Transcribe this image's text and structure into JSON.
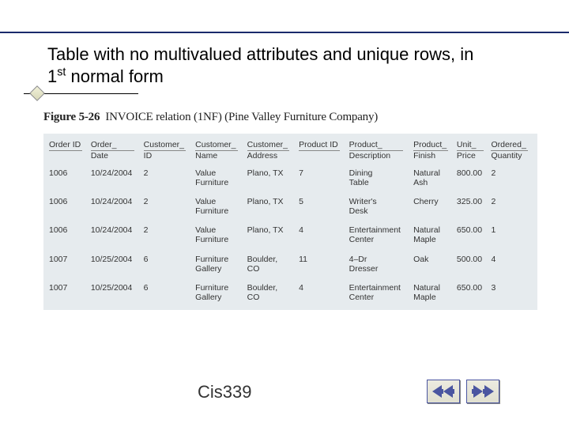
{
  "title_line1": "Table with no multivalued attributes and unique rows, in",
  "title_line2a": "1",
  "title_line2sup": "st",
  "title_line2b": " normal form",
  "figure": {
    "label": "Figure 5-26",
    "desc": "INVOICE relation (1NF) (Pine Valley Furniture Company)"
  },
  "table": {
    "headers": [
      {
        "l1": "Order ID",
        "l2": ""
      },
      {
        "l1": "Order_",
        "l2": "Date"
      },
      {
        "l1": "Customer_",
        "l2": "ID"
      },
      {
        "l1": "Customer_",
        "l2": "Name"
      },
      {
        "l1": "Customer_",
        "l2": "Address"
      },
      {
        "l1": "Product ID",
        "l2": ""
      },
      {
        "l1": "Product_",
        "l2": "Description"
      },
      {
        "l1": "Product_",
        "l2": "Finish"
      },
      {
        "l1": "Unit_",
        "l2": "Price"
      },
      {
        "l1": "Ordered_",
        "l2": "Quantity"
      }
    ],
    "rows": [
      [
        "1006",
        "10/24/2004",
        "2",
        "Value\nFurniture",
        "Plano, TX",
        "7",
        "Dining\nTable",
        "Natural\nAsh",
        "800.00",
        "2"
      ],
      [
        "1006",
        "10/24/2004",
        "2",
        "Value\nFurniture",
        "Plano, TX",
        "5",
        "Writer's\nDesk",
        "Cherry",
        "325.00",
        "2"
      ],
      [
        "1006",
        "10/24/2004",
        "2",
        "Value\nFurniture",
        "Plano, TX",
        "4",
        "Entertainment\nCenter",
        "Natural\nMaple",
        "650.00",
        "1"
      ],
      [
        "1007",
        "10/25/2004",
        "6",
        "Furniture\nGallery",
        "Boulder,\nCO",
        "11",
        "4–Dr\nDresser",
        "Oak",
        "500.00",
        "4"
      ],
      [
        "1007",
        "10/25/2004",
        "6",
        "Furniture\nGallery",
        "Boulder,\nCO",
        "4",
        "Entertainment\nCenter",
        "Natural\nMaple",
        "650.00",
        "3"
      ]
    ]
  },
  "footer": "Cis339",
  "nav": {
    "prev": "prev",
    "next": "next"
  },
  "colors": {
    "accent": "#1a2a6c",
    "tablebg": "#e6ebee"
  }
}
